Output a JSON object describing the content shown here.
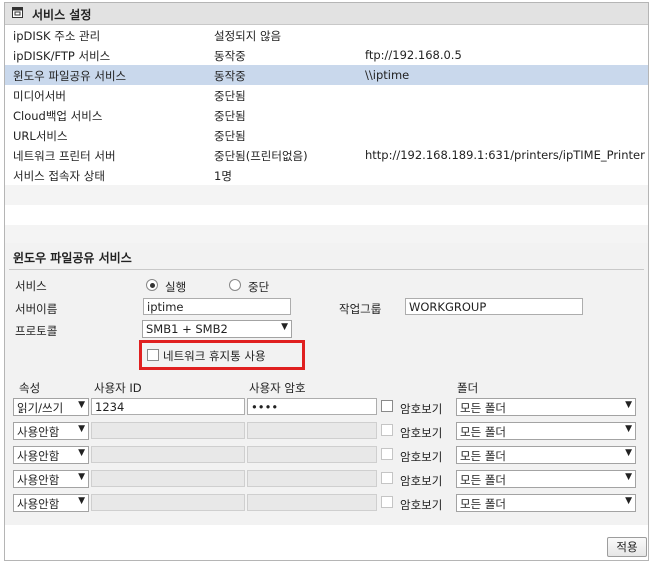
{
  "header": {
    "title": "서비스 설정"
  },
  "services": [
    {
      "name": "ipDISK 주소 관리",
      "status": "설정되지 않음",
      "info": ""
    },
    {
      "name": "ipDISK/FTP 서비스",
      "status": "동작중",
      "info": "ftp://192.168.0.5"
    },
    {
      "name": "윈도우 파일공유 서비스",
      "status": "동작중",
      "info": "\\\\iptime"
    },
    {
      "name": "미디어서버",
      "status": "중단됨",
      "info": ""
    },
    {
      "name": "Cloud백업 서비스",
      "status": "중단됨",
      "info": ""
    },
    {
      "name": "URL서비스",
      "status": "중단됨",
      "info": ""
    },
    {
      "name": "네트워크 프린터 서버",
      "status": "중단됨(프린터없음)",
      "info": "http://192.168.189.1:631/printers/ipTIME_Printer"
    },
    {
      "name": "서비스 접속자 상태",
      "status": "1명",
      "info": ""
    }
  ],
  "share": {
    "title": "윈도우 파일공유 서비스",
    "service_label": "서비스",
    "run_label": "실행",
    "stop_label": "중단",
    "server_name_label": "서버이름",
    "server_name": "iptime",
    "workgroup_label": "작업그룹",
    "workgroup": "WORKGROUP",
    "protocol_label": "프로토콜",
    "protocol": "SMB1 + SMB2",
    "trash_label": "네트워크 휴지통 사용",
    "col_attr": "속성",
    "col_user": "사용자 ID",
    "col_pass": "사용자 암호",
    "col_folder": "폴더",
    "show_pass": "암호보기",
    "users": [
      {
        "attr": "읽기/쓰기",
        "id": "1234",
        "pass": "••••",
        "folder": "모든 폴더"
      },
      {
        "attr": "사용안함",
        "id": "",
        "pass": "",
        "folder": "모든 폴더"
      },
      {
        "attr": "사용안함",
        "id": "",
        "pass": "",
        "folder": "모든 폴더"
      },
      {
        "attr": "사용안함",
        "id": "",
        "pass": "",
        "folder": "모든 폴더"
      },
      {
        "attr": "사용안함",
        "id": "",
        "pass": "",
        "folder": "모든 폴더"
      }
    ]
  },
  "apply_label": "적용"
}
